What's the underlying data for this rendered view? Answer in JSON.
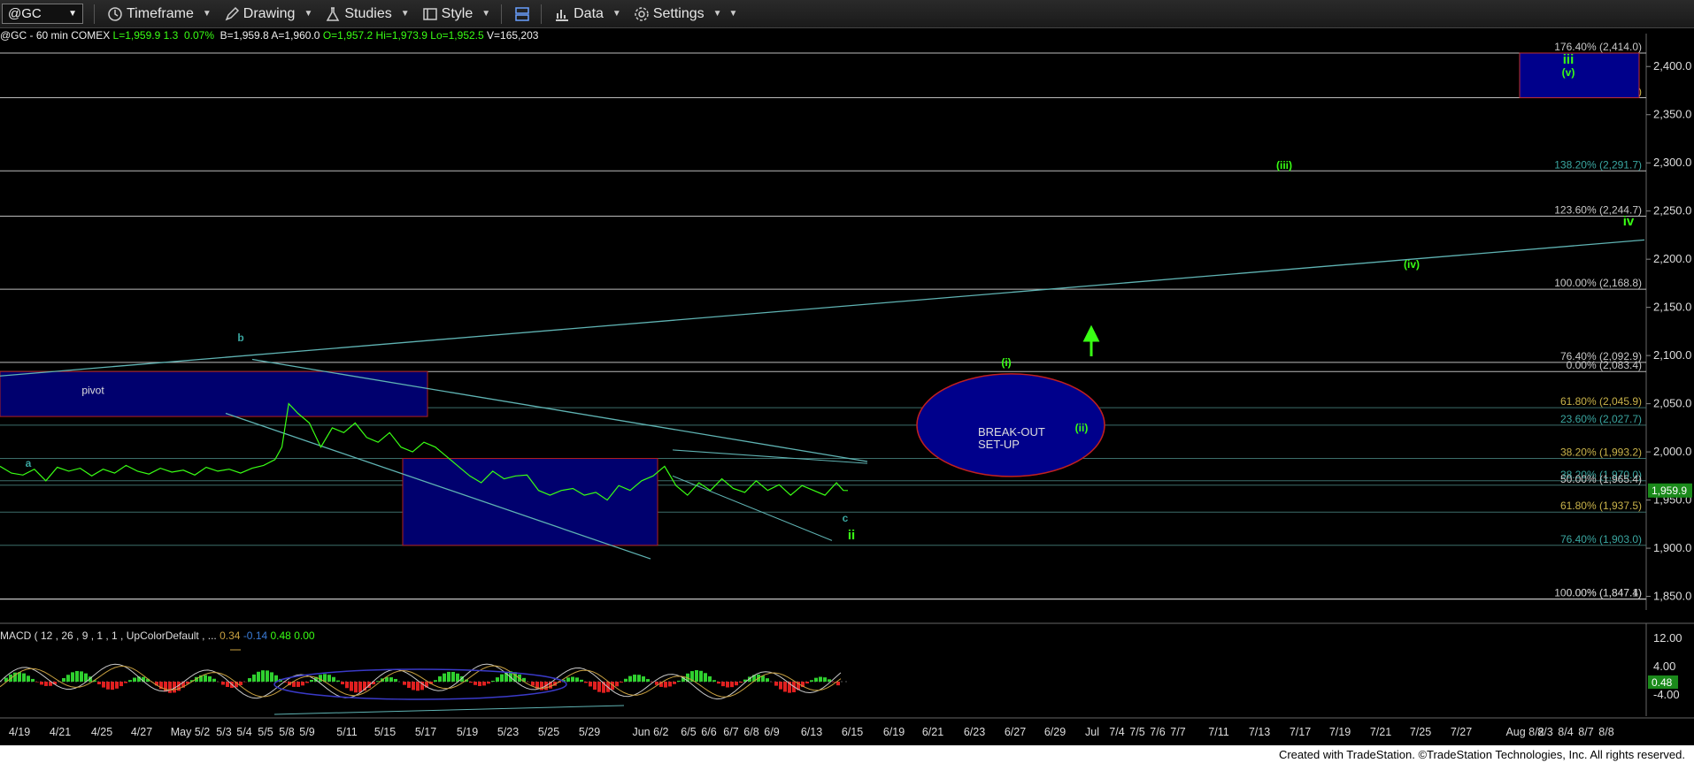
{
  "toolbar": {
    "symbol": "@GC",
    "timeframe_label": "Timeframe",
    "drawing_label": "Drawing",
    "studies_label": "Studies",
    "style_label": "Style",
    "data_label": "Data",
    "settings_label": "Settings"
  },
  "info_bar": {
    "symbol_desc": "@GC - 60 min  COMEX",
    "last": "L=1,959.9",
    "change": "1.3",
    "pct": "0.07%",
    "bid": "B=1,959.8",
    "ask": "A=1,960.0",
    "open": "O=1,957.2",
    "high": "Hi=1,973.9",
    "low": "Lo=1,952.5",
    "volume": "V=165,203"
  },
  "macd": {
    "label": "MACD ( 12 , 26 , 9 , 1 , 1 , UpColorDefault , ...",
    "v1": "0.34",
    "v2": "-0.14",
    "v3": "0.48",
    "v4": "0.00",
    "axis": [
      "12.00",
      "4.00",
      "-4.00"
    ],
    "current": "0.48"
  },
  "footer": "Created with TradeStation. ©TradeStation Technologies, Inc. All rights reserved.",
  "chart_data": {
    "type": "line",
    "symbol": "@GC",
    "interval": "60 min",
    "price_axis": [
      2400,
      2350,
      2300,
      2250,
      2200,
      2150,
      2100,
      2050,
      2000,
      1950,
      1900,
      1850
    ],
    "price_range": [
      1845,
      2425
    ],
    "last_price": "1,959.9",
    "date_ticks": [
      "4/19",
      "4/21",
      "4/25",
      "4/27",
      "May 5/2",
      "5/3",
      "5/4",
      "5/5",
      "5/8",
      "5/9",
      "5/11",
      "5/15",
      "5/17",
      "5/19",
      "5/23",
      "5/25",
      "5/29",
      "Jun 6/2",
      "6/5",
      "6/6",
      "6/7",
      "6/8",
      "6/9",
      "6/13",
      "6/15",
      "6/19",
      "6/21",
      "6/23",
      "6/27",
      "6/29",
      "Jul",
      "7/4",
      "7/5",
      "7/6",
      "7/7",
      "7/11",
      "7/13",
      "7/17",
      "7/19",
      "7/21",
      "7/25",
      "7/27",
      "Aug 8/2",
      "8/3",
      "8/4",
      "8/7",
      "8/8"
    ],
    "fib_levels": [
      {
        "label": "176.40% (2,414.0)",
        "price": 2414.0
      },
      {
        "label": "161.80% (2,367.6)",
        "price": 2367.6
      },
      {
        "label": "138.20% (2,291.7)",
        "price": 2291.7
      },
      {
        "label": "123.60% (2,244.7)",
        "price": 2244.7
      },
      {
        "label": "100.00% (2,168.8)",
        "price": 2168.8
      },
      {
        "label": "76.40% (2,092.9)",
        "price": 2092.9
      },
      {
        "label": "0.00% (2,083.4)",
        "price": 2083.4
      },
      {
        "label": "61.80% (2,045.9)",
        "price": 2045.9
      },
      {
        "label": "23.60% (2,027.7)",
        "price": 2027.7
      },
      {
        "label": "38.20% (1,993.2)",
        "price": 1993.2
      },
      {
        "label": "38.20% (1,970.0)",
        "price": 1970.0
      },
      {
        "label": "50.00% (1,965.4)",
        "price": 1965.4
      },
      {
        "label": "61.80% (1,937.5)",
        "price": 1937.5
      },
      {
        "label": "76.40% (1,903.0)",
        "price": 1903.0
      },
      {
        "label": "100.00% (1,847.1)",
        "price": 1847.1
      },
      {
        "label": "0.00% (1,847.4)",
        "price": 1847.4
      }
    ],
    "wave_labels": [
      "a",
      "b",
      "c",
      "ii",
      "(i)",
      "(ii)",
      "(iii)",
      "(iv)",
      "iv",
      "iii",
      "(v)"
    ],
    "annotations": [
      "pivot",
      "BREAK-OUT",
      "SET-UP"
    ],
    "price_series": [
      [
        0,
        1985
      ],
      [
        5,
        1978
      ],
      [
        10,
        1976
      ],
      [
        15,
        1982
      ],
      [
        20,
        1970
      ],
      [
        25,
        1984
      ],
      [
        30,
        1980
      ],
      [
        35,
        1983
      ],
      [
        40,
        1975
      ],
      [
        45,
        1982
      ],
      [
        50,
        1978
      ],
      [
        55,
        1986
      ],
      [
        60,
        1980
      ],
      [
        65,
        1977
      ],
      [
        70,
        1983
      ],
      [
        75,
        1979
      ],
      [
        80,
        1981
      ],
      [
        85,
        1976
      ],
      [
        90,
        1984
      ],
      [
        95,
        1980
      ],
      [
        100,
        1982
      ],
      [
        105,
        1978
      ],
      [
        110,
        1983
      ],
      [
        115,
        1986
      ],
      [
        120,
        1992
      ],
      [
        123,
        2005
      ],
      [
        126,
        2050
      ],
      [
        130,
        2040
      ],
      [
        135,
        2030
      ],
      [
        140,
        2005
      ],
      [
        145,
        2025
      ],
      [
        150,
        2020
      ],
      [
        155,
        2030
      ],
      [
        160,
        2015
      ],
      [
        165,
        2010
      ],
      [
        170,
        2020
      ],
      [
        175,
        2005
      ],
      [
        180,
        2000
      ],
      [
        185,
        2010
      ],
      [
        190,
        2005
      ],
      [
        195,
        1995
      ],
      [
        200,
        1985
      ],
      [
        205,
        1975
      ],
      [
        210,
        1968
      ],
      [
        215,
        1980
      ],
      [
        220,
        1972
      ],
      [
        225,
        1975
      ],
      [
        230,
        1976
      ],
      [
        235,
        1960
      ],
      [
        240,
        1955
      ],
      [
        245,
        1960
      ],
      [
        250,
        1962
      ],
      [
        255,
        1955
      ],
      [
        260,
        1958
      ],
      [
        265,
        1950
      ],
      [
        270,
        1965
      ],
      [
        275,
        1960
      ],
      [
        280,
        1970
      ],
      [
        285,
        1975
      ],
      [
        290,
        1985
      ],
      [
        295,
        1965
      ],
      [
        300,
        1955
      ],
      [
        305,
        1968
      ],
      [
        310,
        1960
      ],
      [
        315,
        1972
      ],
      [
        320,
        1962
      ],
      [
        325,
        1958
      ],
      [
        330,
        1970
      ],
      [
        335,
        1960
      ],
      [
        340,
        1966
      ],
      [
        345,
        1955
      ],
      [
        350,
        1965
      ],
      [
        355,
        1960
      ],
      [
        360,
        1955
      ],
      [
        365,
        1968
      ],
      [
        368,
        1960
      ],
      [
        370,
        1959.9
      ]
    ]
  }
}
